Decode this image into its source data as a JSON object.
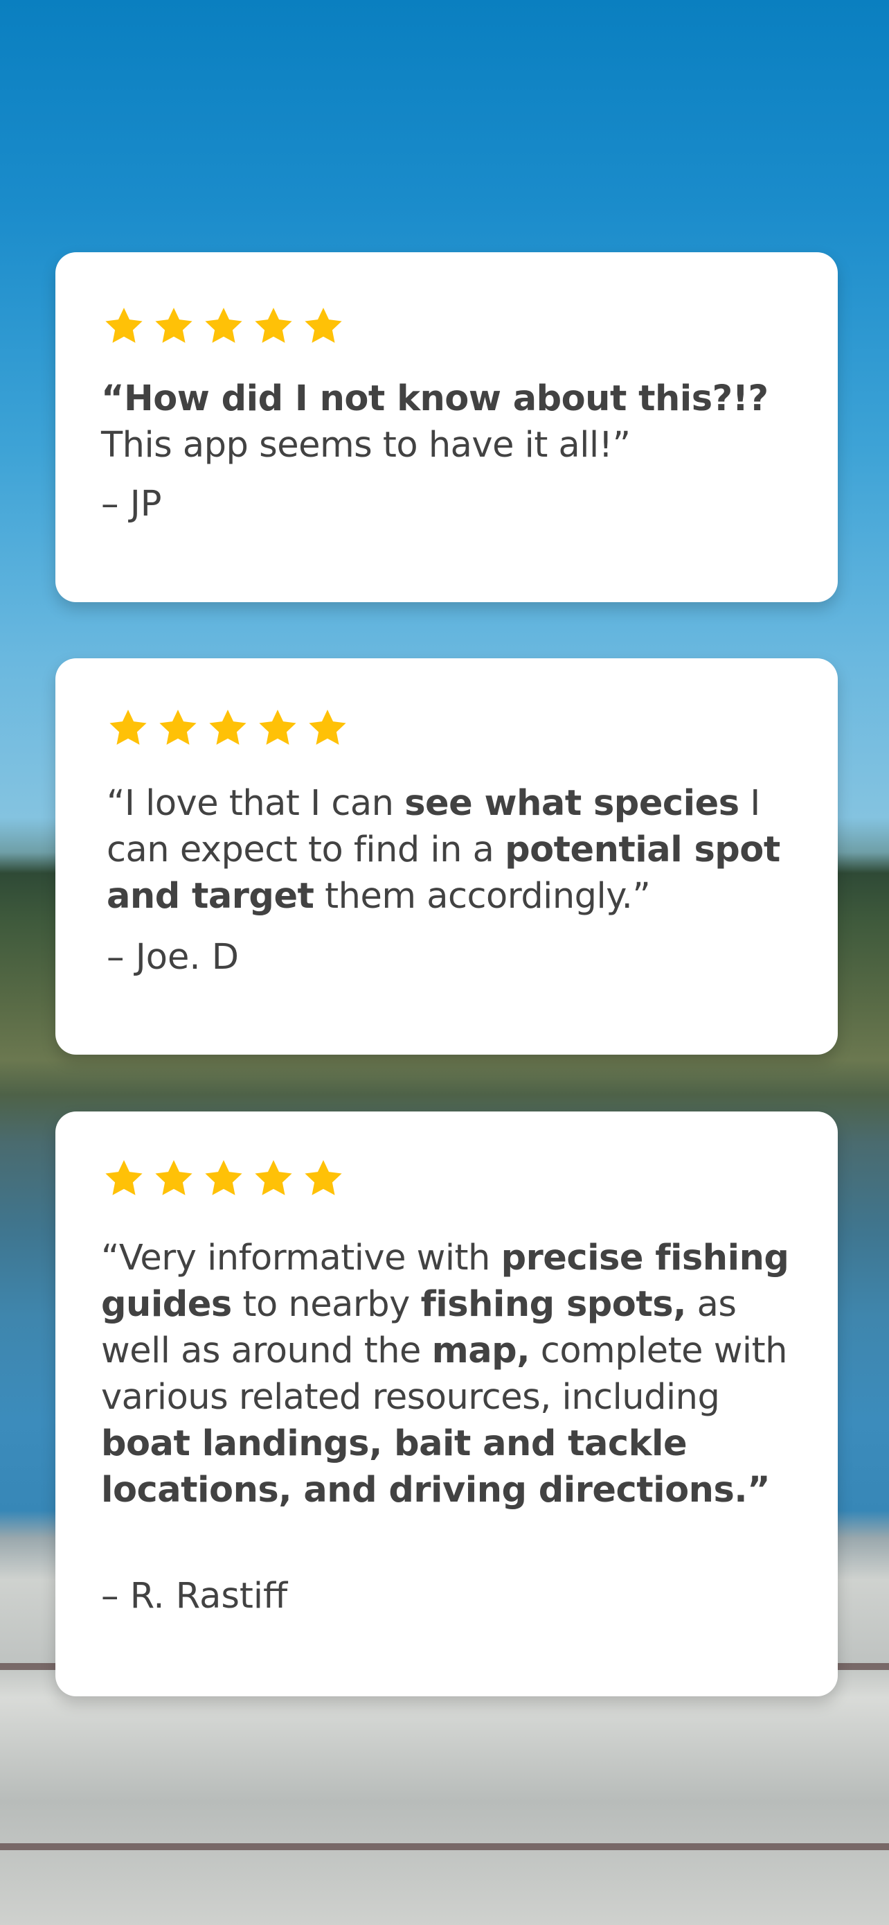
{
  "background": {
    "description_colors": {
      "sky_top": "#0a7fc0",
      "sky_bottom": "#84c3e0",
      "treeline": "#3f5a3c",
      "water": "#3f86ad",
      "dock_wood": "#cfd2cf"
    }
  },
  "theme": {
    "star_color": "#FFC107",
    "card_background": "#ffffff",
    "text_color": "#424242"
  },
  "reviews": [
    {
      "rating": 5,
      "quote_segments": [
        {
          "text": "“How did I not know about this?!?",
          "bold": true
        },
        {
          "text": " This app seems to have it all!”",
          "bold": false
        }
      ],
      "author": "– JP"
    },
    {
      "rating": 5,
      "quote_segments": [
        {
          "text": "“I love that I can ",
          "bold": false
        },
        {
          "text": "see what species",
          "bold": true
        },
        {
          "text": " I can expect to find in a ",
          "bold": false
        },
        {
          "text": "potential spot and target",
          "bold": true
        },
        {
          "text": " them accordingly.”",
          "bold": false
        }
      ],
      "author": "– Joe. D"
    },
    {
      "rating": 5,
      "quote_segments": [
        {
          "text": "“Very informative with ",
          "bold": false
        },
        {
          "text": "precise fishing guides",
          "bold": true
        },
        {
          "text": " to nearby ",
          "bold": false
        },
        {
          "text": "fishing spots,",
          "bold": true
        },
        {
          "text": " as well as around the ",
          "bold": false
        },
        {
          "text": "map,",
          "bold": true
        },
        {
          "text": " complete with various related resources, including ",
          "bold": false
        },
        {
          "text": "boat landings, bait and tackle locations, and driving directions.”",
          "bold": true
        }
      ],
      "author": "– R. Rastiff"
    }
  ]
}
